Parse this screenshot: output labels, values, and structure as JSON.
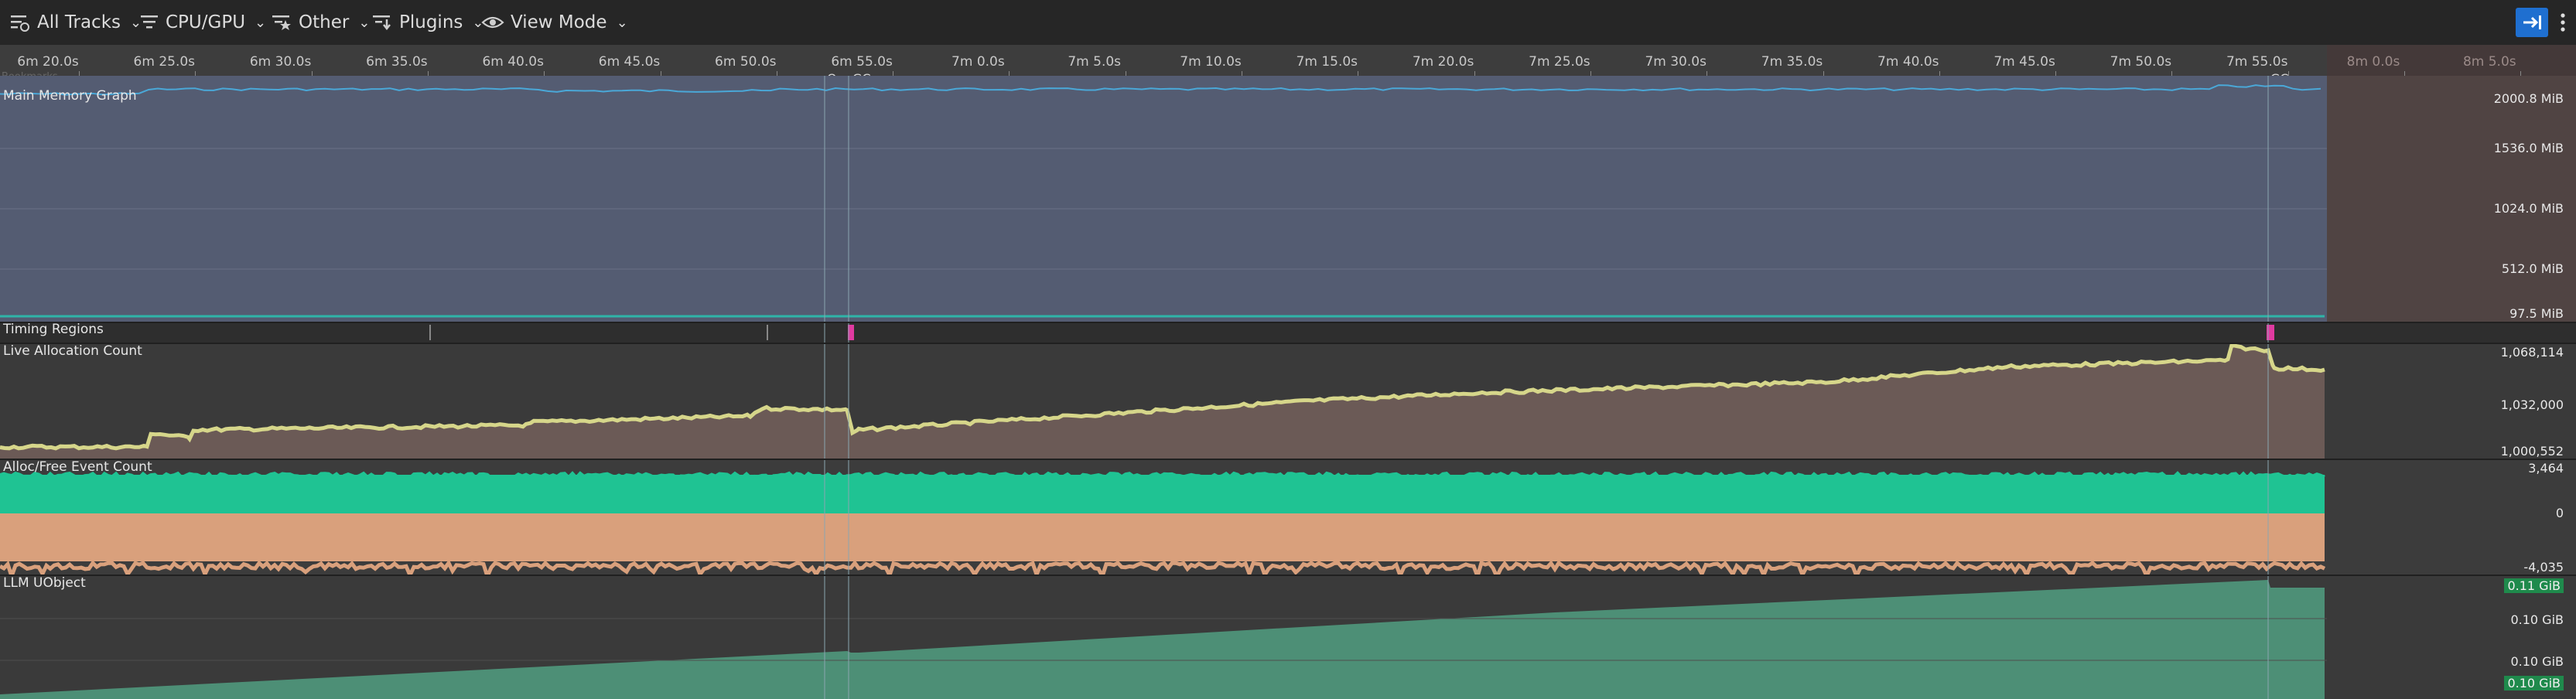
{
  "toolbar": {
    "all_tracks_label": "All Tracks",
    "cpu_gpu_label": "CPU/GPU",
    "other_label": "Other",
    "plugins_label": "Plugins",
    "view_mode_label": "View Mode"
  },
  "ruler": {
    "ticks": [
      "6m 20.0s",
      "6m 25.0s",
      "6m 30.0s",
      "6m 35.0s",
      "6m 40.0s",
      "6m 45.0s",
      "6m 50.0s",
      "6m 55.0s",
      "7m 0.0s",
      "7m 5.0s",
      "7m 10.0s",
      "7m 15.0s",
      "7m 20.0s",
      "7m 25.0s",
      "7m 30.0s",
      "7m 35.0s",
      "7m 40.0s",
      "7m 45.0s",
      "7m 50.0s",
      "7m 55.0s",
      "8m 0.0s",
      "8m 5.0s"
    ],
    "markers": [
      "Qu",
      "GC",
      "GC"
    ],
    "bookmarks_label": "Bookmarks"
  },
  "tracks": {
    "main_memory": {
      "title": "Main Memory Graph",
      "axis": [
        "2000.8 MiB",
        "1536.0 MiB",
        "1024.0 MiB",
        "512.0 MiB",
        "97.5 MiB"
      ]
    },
    "timing_regions": {
      "title": "Timing Regions"
    },
    "live_alloc": {
      "title": "Live Allocation Count",
      "axis": [
        "1,068,114",
        "1,032,000",
        "1,000,552"
      ]
    },
    "alloc_free": {
      "title": "Alloc/Free Event Count",
      "axis": [
        "3,464",
        "0",
        "-4,035"
      ]
    },
    "llm_uobject": {
      "title": "LLM UObject",
      "axis": [
        "0.11 GiB",
        "0.10 GiB",
        "0.10 GiB",
        "0.10 GiB"
      ]
    }
  },
  "colors": {
    "memory_fill": "#545c72",
    "memory_line": "#4aa8d8",
    "live_line": "#d6d68a",
    "live_fill": "#6b5a56",
    "alloc_pos": "#1fc393",
    "alloc_neg": "#d9a07c",
    "llm_fill": "#4d8f76",
    "accent": "#1f6fd0"
  }
}
